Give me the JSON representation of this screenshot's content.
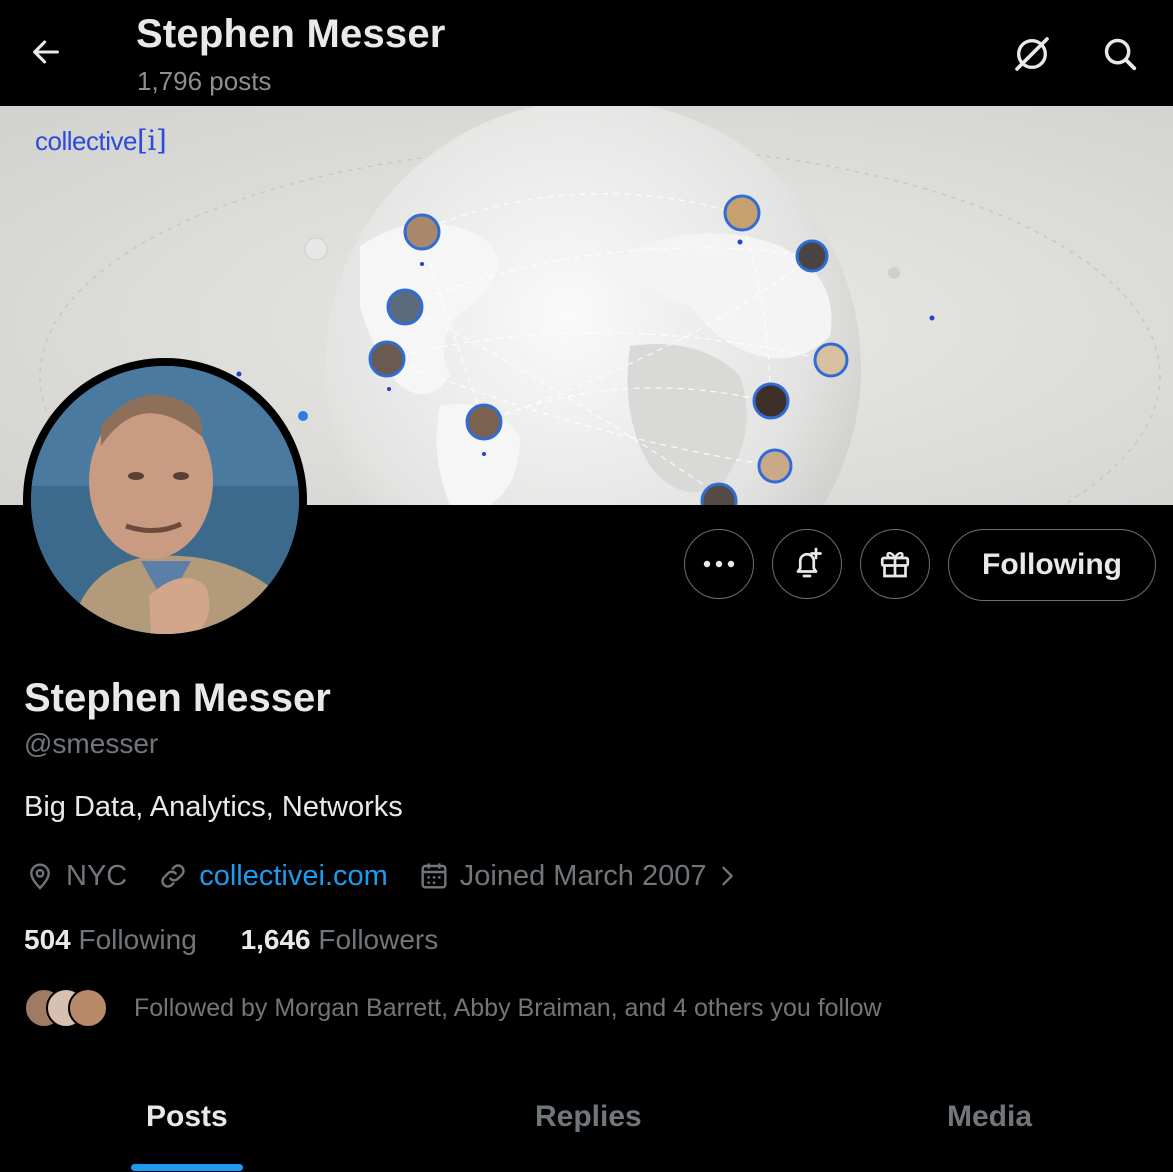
{
  "header": {
    "title": "Stephen Messer",
    "posts_count": "1,796 posts",
    "back_icon": "arrow-left-icon",
    "grok_icon": "grok-icon",
    "search_icon": "search-icon"
  },
  "banner": {
    "brand_text": "collective",
    "brand_bracket": "[i]",
    "brand_color": "#2b4bd8"
  },
  "actions": {
    "more_icon": "more-horizontal-icon",
    "notify_icon": "bell-plus-icon",
    "subscribe_icon": "gift-icon",
    "follow_label": "Following"
  },
  "profile": {
    "name": "Stephen Messer",
    "handle": "@smesser",
    "bio": "Big Data, Analytics, Networks",
    "location": "NYC",
    "website": "collectivei.com",
    "joined": "Joined March 2007",
    "following_count": "504",
    "following_label": "Following",
    "followers_count": "1,646",
    "followers_label": "Followers",
    "followed_by": "Followed by Morgan Barrett, Abby Braiman, and 4 others you follow"
  },
  "tabs": [
    {
      "label": "Posts",
      "active": true
    },
    {
      "label": "Replies",
      "active": false
    },
    {
      "label": "Media",
      "active": false
    }
  ],
  "colors": {
    "accent": "#1d9bf0",
    "background": "#000000",
    "muted_text": "#71767b"
  }
}
